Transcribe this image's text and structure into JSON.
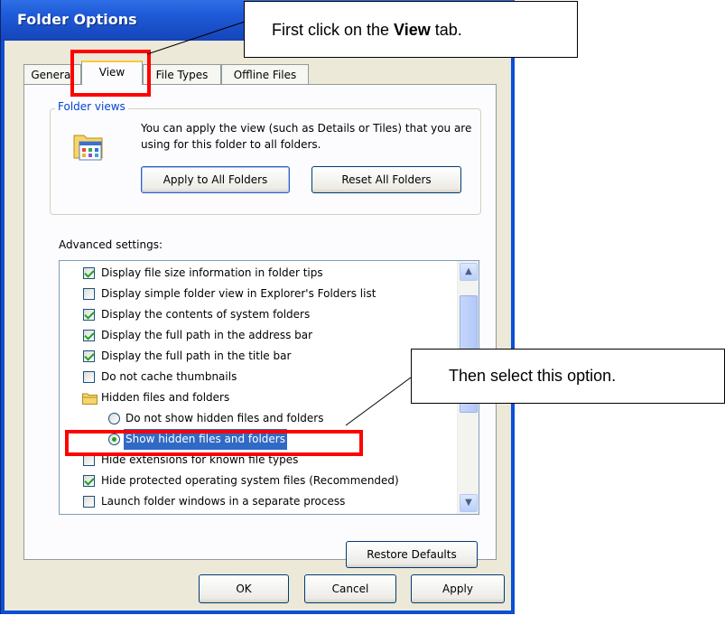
{
  "window": {
    "title": "Folder Options"
  },
  "tabs": [
    "General",
    "View",
    "File Types",
    "Offline Files"
  ],
  "folder_views": {
    "label": "Folder views",
    "description": "You can apply the view (such as Details or Tiles) that you are using for this folder to all folders.",
    "apply_button": "Apply to All Folders",
    "reset_button": "Reset All Folders"
  },
  "advanced": {
    "label": "Advanced settings:",
    "items": [
      {
        "type": "checkbox",
        "checked": true,
        "label": "Display file size information in folder tips"
      },
      {
        "type": "checkbox",
        "checked": false,
        "label": "Display simple folder view in Explorer's Folders list"
      },
      {
        "type": "checkbox",
        "checked": true,
        "label": "Display the contents of system folders"
      },
      {
        "type": "checkbox",
        "checked": true,
        "label": "Display the full path in the address bar"
      },
      {
        "type": "checkbox",
        "checked": true,
        "label": "Display the full path in the title bar"
      },
      {
        "type": "checkbox",
        "checked": false,
        "label": "Do not cache thumbnails"
      },
      {
        "type": "folder",
        "label": "Hidden files and folders"
      },
      {
        "type": "radio",
        "selected": false,
        "label": "Do not show hidden files and folders"
      },
      {
        "type": "radio",
        "selected": true,
        "label": "Show hidden files and folders"
      },
      {
        "type": "checkbox",
        "checked": false,
        "label": "Hide extensions for known file types"
      },
      {
        "type": "checkbox",
        "checked": true,
        "label": "Hide protected operating system files (Recommended)"
      },
      {
        "type": "checkbox",
        "checked": false,
        "label": "Launch folder windows in a separate process"
      }
    ],
    "restore_button": "Restore Defaults"
  },
  "footer": {
    "ok": "OK",
    "cancel": "Cancel",
    "apply": "Apply"
  },
  "callouts": {
    "top_prefix": "First click on the ",
    "top_bold": "View",
    "top_suffix": " tab.",
    "right": "Then select this option."
  },
  "colors": {
    "titlebar": "#1f5bd8",
    "highlight_box": "#ff0000",
    "selection": "#316ac5",
    "group_label": "#0046d5"
  },
  "icons": {
    "folder_views": "folder-views-icon",
    "hidden_folder": "folder-icon",
    "scroll_up": "chevron-up-icon",
    "scroll_down": "chevron-down-icon"
  }
}
